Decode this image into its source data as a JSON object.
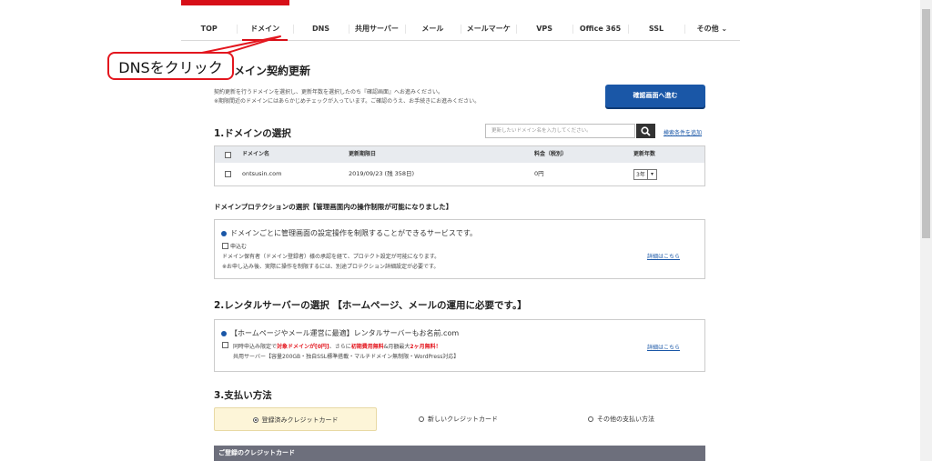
{
  "nav": {
    "items": [
      {
        "label": "TOP"
      },
      {
        "label": "ドメイン"
      },
      {
        "label": "DNS"
      },
      {
        "label": "共用サーバー"
      },
      {
        "label": "メール"
      },
      {
        "label": "メールマーケ"
      },
      {
        "label": "VPS"
      },
      {
        "label": "Office 365"
      },
      {
        "label": "SSL"
      },
      {
        "label": "その他 ⌄"
      }
    ]
  },
  "callout": {
    "text": "DNSをクリック"
  },
  "page": {
    "title": "メイン契約更新",
    "note1": "契約更新を行うドメインを選択し、更新年数を選択したのち『確認画面』へお進みください。",
    "note2": "※期限間近のドメインにはあらかじめチェックが入っています。ご確認のうえ、お手続きにお進みください。",
    "confirm_button": "確認画面へ進む"
  },
  "domain_select": {
    "heading": "1.ドメインの選択",
    "search_placeholder": "更新したいドメイン名を入力してください。",
    "search_condition_link": "検索条件を追加",
    "columns": [
      "ドメイン名",
      "更新期限日",
      "料金（税別）",
      "更新年数"
    ],
    "rows": [
      {
        "domain": "ontsusin.com",
        "expiry": "2019/09/23 (残 358日)",
        "price": "0円",
        "years": "3年"
      }
    ]
  },
  "protection": {
    "heading": "ドメインプロテクションの選択【管理画面内の操作制限が可能になりました】",
    "title": "ドメインごとに管理画面の設定操作を制限することができるサービスです。",
    "apply_label": "申込む",
    "desc1": "ドメイン保有者（ドメイン登録者）様の承認を経て、プロテクト設定が可能になります。",
    "desc2": "※お申し込み後、実際に操作を制限するには、別途プロテクション詳細設定が必要です。",
    "details_link": "詳細はこちら"
  },
  "server": {
    "heading": "2.レンタルサーバーの選択 【ホームページ、メールの運用に必要です。】",
    "title": "【ホームページやメール運営に最適】レンタルサーバーもお名前.com",
    "line1_a": "同時申込み限定で",
    "line1_b": "対象ドメインが[0円]",
    "line1_c": "、さらに",
    "line1_d": "初期費用無料",
    "line1_e": "&月額最大",
    "line1_f": "2ヶ月無料！",
    "line2": "共用サーバー【容量200GB・独自SSL標準搭載・マルチドメイン無制限・WordPress対応】",
    "details_link": "詳細はこちら"
  },
  "payment": {
    "heading": "3.支払い方法",
    "options": [
      {
        "label": "登録済みクレジットカード",
        "selected": true
      },
      {
        "label": "新しいクレジットカード",
        "selected": false
      },
      {
        "label": "その他の支払い方法",
        "selected": false
      }
    ],
    "registered_cards_header": "ご登録のクレジットカード"
  },
  "colors": {
    "accent_red": "#d70f18",
    "primary_blue": "#1a57a7",
    "highlight_red": "#e3161e"
  }
}
